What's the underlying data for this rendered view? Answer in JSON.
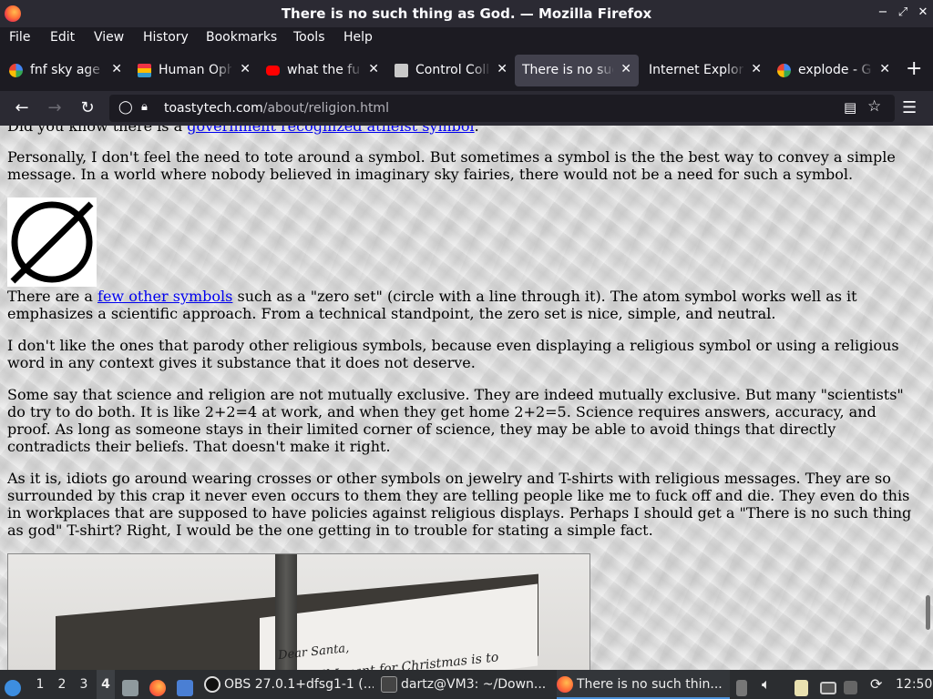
{
  "window": {
    "title": "There is no such thing as God. — Mozilla Firefox",
    "minimize_glyph": "−",
    "maximize_glyph": "⤢",
    "close_glyph": "✕"
  },
  "menubar": {
    "items": [
      "File",
      "Edit",
      "View",
      "History",
      "Bookmarks",
      "Tools",
      "Help"
    ]
  },
  "tabs": [
    {
      "label": "fnf sky age - Google",
      "icon": "google-icon",
      "active": false
    },
    {
      "label": "Human Ophrys",
      "icon": "site-icon",
      "active": false
    },
    {
      "label": "what the fuck",
      "icon": "youtube-icon",
      "active": false
    },
    {
      "label": "Control Collapse",
      "icon": "site-icon",
      "active": false
    },
    {
      "label": "There is no such thing",
      "icon": "none",
      "active": true
    },
    {
      "label": "Internet Explorer",
      "icon": "none",
      "active": false
    },
    {
      "label": "explode - Google",
      "icon": "google-icon",
      "active": false
    }
  ],
  "tab_close_glyph": "✕",
  "newtab_glyph": "+",
  "nav": {
    "url_domain": "toastytech.com",
    "url_path": "/about/religion.html"
  },
  "article": {
    "partial_top_prefix": "Did you know there is a ",
    "partial_top_link": "government recognized atheist symbol",
    "partial_top_suffix": ".",
    "p1": "Personally, I don't feel the need to tote around a symbol. But sometimes a symbol is the the best way to convey a simple message. In a world where nobody believed in imaginary sky fairies, there would not be a need for such a symbol.",
    "p2_prefix": "There are a ",
    "p2_link": "few other symbols",
    "p2_suffix": " such as a \"zero set\" (circle with a line through it). The atom symbol works well as it emphasizes a scientific approach. From a technical standpoint, the zero set is nice, simple, and neutral.",
    "p3": "I don't like the ones that parody other religious symbols, because even displaying a religious symbol or using a religious word in any context gives it substance that it does not deserve.",
    "p4": "Some say that science and religion are not mutually exclusive. They are indeed mutually exclusive. But many \"scientists\" do try to do both. It is like 2+2=4 at work, and when they get home 2+2=5. Science requires answers, accuracy, and proof. As long as someone stays in their limited corner of science, they may be able to avoid things that directly contradicts their beliefs. That doesn't make it right.",
    "p5": "As it is, idiots go around wearing crosses or other symbols on jewelry and T-shirts with religious messages. They are so surrounded by this crap it never even occurs to them they are telling people like me to fuck off and die. They even do this in workplaces that are supposed to have policies against religious displays. Perhaps I should get a \"There is no such thing as god\" T-shirt? Right, I would be the one getting in to trouble for stating a simple fact.",
    "billboard_line1": "Dear Santa,",
    "billboard_line2": "All I want for Christmas is to"
  },
  "taskbar": {
    "workspaces": [
      "1",
      "2",
      "3",
      "4"
    ],
    "active_workspace": "4",
    "apps": [
      {
        "label": "OBS 27.0.1+dfsg1-1 (...",
        "icon": "obs-icon"
      },
      {
        "label": "dartz@VM3: ~/Down...",
        "icon": "terminal-icon"
      },
      {
        "label": "There is no such thin...",
        "icon": "firefox-icon",
        "active": true
      }
    ],
    "clock": "12:50"
  },
  "colors": {
    "link": "#0000ee",
    "chrome_dark": "#1c1b22",
    "chrome_mid": "#2b2a33",
    "active_tab": "#42414d"
  }
}
